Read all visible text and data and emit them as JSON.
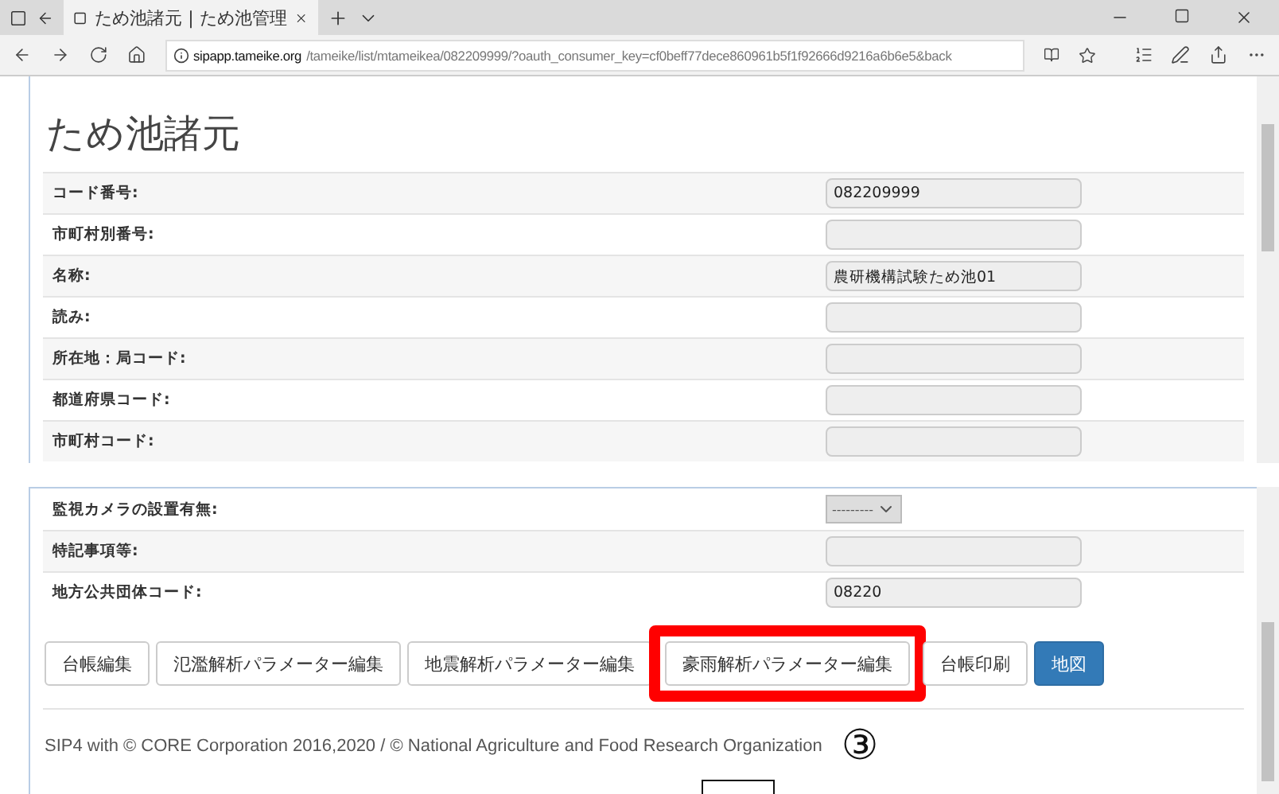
{
  "browser": {
    "tab_title": "ため池諸元 | ため池管理",
    "url_host": "sipapp.tameike.org",
    "url_path": "/tameike/list/mtameikea/082209999/?oauth_consumer_key=cf0beff77dece860961b5f1f92666d9216a6b6e5&back"
  },
  "heading": "ため池諸元",
  "top_fields": [
    {
      "label": "コード番号:",
      "value": "082209999"
    },
    {
      "label": "市町村別番号:"
    },
    {
      "label": "名称:",
      "value": "農研機構試験ため池01"
    },
    {
      "label": "読み:"
    },
    {
      "label": "所在地：局コード:"
    },
    {
      "label": "都道府県コード:"
    },
    {
      "label": "市町村コード:"
    }
  ],
  "bottom_fields": [
    {
      "label": "監視カメラの設置有無:",
      "kind": "select",
      "value": "---------"
    },
    {
      "label": "特記事項等:",
      "kind": "text"
    },
    {
      "label": "地方公共団体コード:",
      "kind": "text",
      "value": "08220"
    }
  ],
  "buttons": [
    {
      "label": "台帳編集",
      "primary": false,
      "highlighted": false
    },
    {
      "label": "氾濫解析パラメーター編集",
      "primary": false,
      "highlighted": false
    },
    {
      "label": "地震解析パラメーター編集",
      "primary": false,
      "highlighted": false
    },
    {
      "label": "豪雨解析パラメーター編集",
      "primary": false,
      "highlighted": true
    },
    {
      "label": "台帳印刷",
      "primary": false,
      "highlighted": false
    },
    {
      "label": "地図",
      "primary": true,
      "highlighted": false
    }
  ],
  "footer": "SIP4 with © CORE Corporation 2016,2020 / © National Agriculture and Food Research Organization",
  "annotation": "③"
}
